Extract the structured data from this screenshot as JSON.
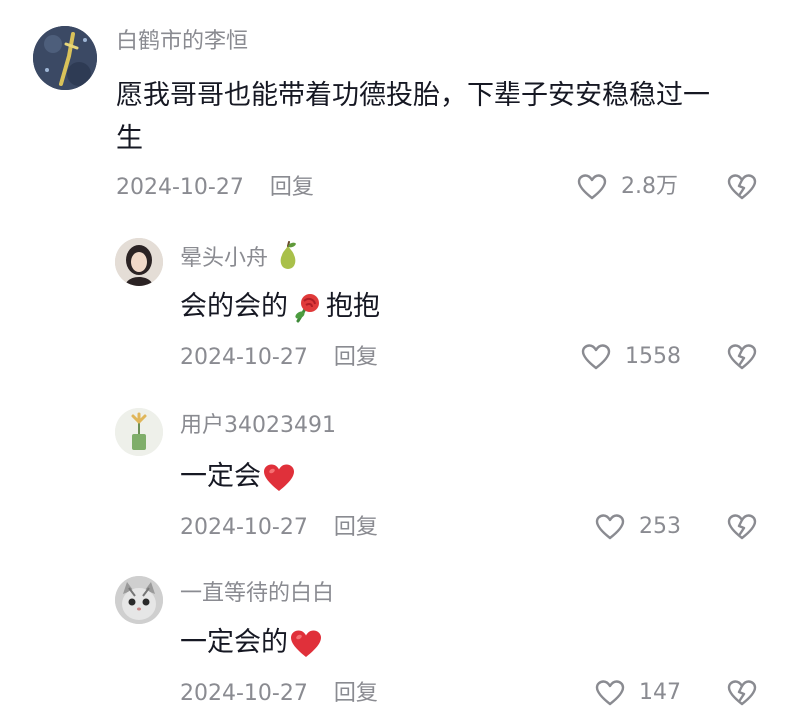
{
  "comments": [
    {
      "username": "白鹤市的李恒",
      "text_line1": "愿我哥哥也能带着功德投胎，下辈子安安稳稳过一",
      "text_line2": "生",
      "date": "2024-10-27",
      "reply_label": "回复",
      "likes": "2.8万"
    },
    {
      "username": "晕头小舟",
      "text_before": "会的会的",
      "text_after": "抱抱",
      "date": "2024-10-27",
      "reply_label": "回复",
      "likes": "1558"
    },
    {
      "username": "用户34023491",
      "text": "一定会",
      "date": "2024-10-27",
      "reply_label": "回复",
      "likes": "253"
    },
    {
      "username": "一直等待的白白",
      "text": "一定会的",
      "date": "2024-10-27",
      "reply_label": "回复",
      "likes": "147"
    }
  ],
  "icons": {
    "like": "heart-outline-icon",
    "dislike": "broken-heart-icon",
    "username_badge": "pear-emoji",
    "rose": "rose-emoji",
    "red_heart": "red-heart-emoji"
  },
  "colors": {
    "text_primary": "#161823",
    "text_secondary": "#8a8b91",
    "heart_red": "#e0303a"
  }
}
